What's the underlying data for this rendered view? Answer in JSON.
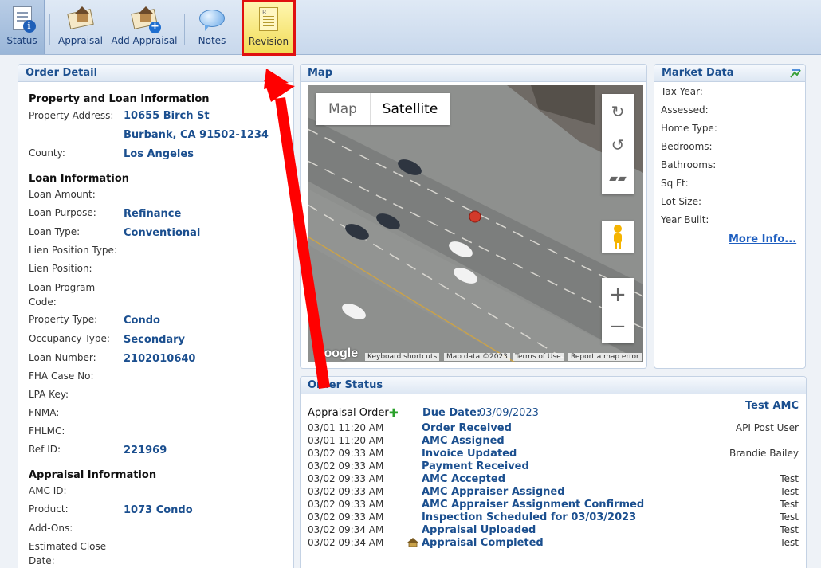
{
  "toolbar": {
    "status": "Status",
    "appraisal": "Appraisal",
    "add_appraisal": "Add Appraisal",
    "notes": "Notes",
    "revision": "Revision"
  },
  "order_detail": {
    "title": "Order Detail",
    "property_section": "Property and Loan Information",
    "property_address_label": "Property Address:",
    "address_line1": "10655 Birch St",
    "address_line2": "Burbank, CA 91502-1234",
    "county_label": "County:",
    "county": "Los Angeles",
    "loan_section": "Loan Information",
    "loan_amount_label": "Loan Amount:",
    "loan_purpose_label": "Loan Purpose:",
    "loan_purpose": "Refinance",
    "loan_type_label": "Loan Type:",
    "loan_type": "Conventional",
    "lien_type_label": "Lien Position Type:",
    "lien_position_label": "Lien Position:",
    "program_label_1": "Loan Program",
    "program_label_2": "Code:",
    "property_type_label": "Property Type:",
    "property_type": "Condo",
    "occupancy_label": "Occupancy Type:",
    "occupancy": "Secondary",
    "loan_number_label": "Loan Number:",
    "loan_number": "2102010640",
    "fha_label": "FHA Case No:",
    "lpa_label": "LPA Key:",
    "fnma_label": "FNMA:",
    "fhlmc_label": "FHLMC:",
    "ref_label": "Ref ID:",
    "ref_id": "221969",
    "appraisal_section": "Appraisal Information",
    "amc_label": "AMC ID:",
    "product_label": "Product:",
    "product": "1073 Condo",
    "addons_label": "Add-Ons:",
    "close_label_1": "Estimated Close",
    "close_label_2": "Date:"
  },
  "map": {
    "title": "Map",
    "map_btn": "Map",
    "satellite_btn": "Satellite",
    "google": "Google",
    "keyboard": "Keyboard shortcuts",
    "map_data": "Map data ©2023",
    "terms": "Terms of Use",
    "report": "Report a map error"
  },
  "market": {
    "title": "Market Data",
    "tax_year": "Tax Year:",
    "assessed": "Assessed:",
    "home_type": "Home Type:",
    "bedrooms": "Bedrooms:",
    "bathrooms": "Bathrooms:",
    "sqft": "Sq Ft:",
    "lot_size": "Lot Size:",
    "year_built": "Year Built:",
    "more_info": "More Info..."
  },
  "order_status": {
    "title": "Order Status",
    "company": "Test AMC",
    "appraisal_order": "Appraisal Order",
    "due_label": "Due Date:",
    "due_date": "03/09/2023",
    "events": [
      {
        "time": "03/01 11:20 AM",
        "event": "Order Received",
        "user": "API Post User"
      },
      {
        "time": "03/01 11:20 AM",
        "event": "AMC Assigned",
        "user": ""
      },
      {
        "time": "03/02 09:33 AM",
        "event": "Invoice Updated",
        "user": "Brandie Bailey"
      },
      {
        "time": "03/02 09:33 AM",
        "event": "Payment Received",
        "user": ""
      },
      {
        "time": "03/02 09:33 AM",
        "event": "AMC Accepted",
        "user": "Test"
      },
      {
        "time": "03/02 09:33 AM",
        "event": "AMC Appraiser Assigned",
        "user": "Test"
      },
      {
        "time": "03/02 09:33 AM",
        "event": "AMC Appraiser Assignment Confirmed",
        "user": "Test"
      },
      {
        "time": "03/02 09:33 AM",
        "event": "Inspection Scheduled for 03/03/2023",
        "user": "Test"
      },
      {
        "time": "03/02 09:34 AM",
        "event": "Appraisal Uploaded",
        "user": "Test"
      },
      {
        "time": "03/02 09:34 AM",
        "event": "Appraisal Completed",
        "user": "Test"
      }
    ]
  },
  "colors": {
    "accent": "#1b4f8f",
    "highlight_border": "#e01010",
    "arrow": "#ff0000"
  }
}
